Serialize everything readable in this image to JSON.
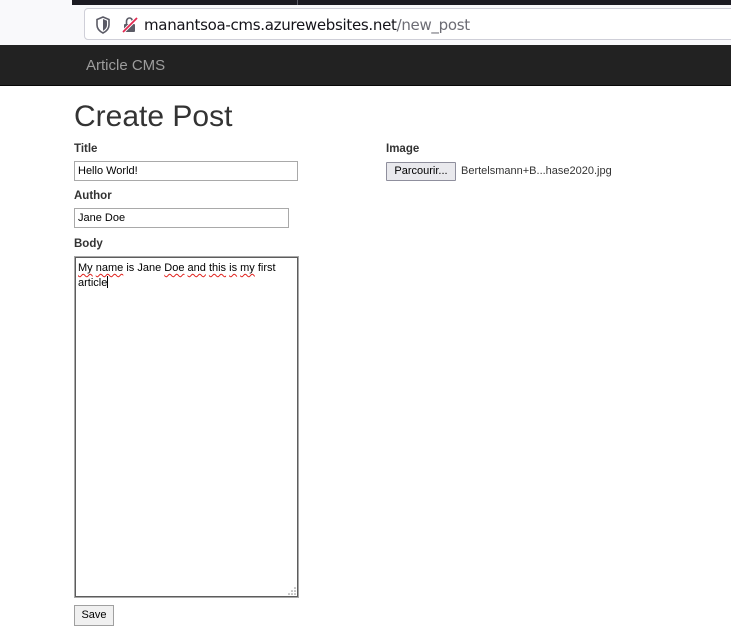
{
  "browser": {
    "url_domain": "manantsoa-cms.azurewebsites.net",
    "url_path": "/new_post"
  },
  "navbar": {
    "brand": "Article CMS"
  },
  "page": {
    "title": "Create Post"
  },
  "form": {
    "title_label": "Title",
    "title_value": "Hello World!",
    "author_label": "Author",
    "author_value": "Jane Doe",
    "body_label": "Body",
    "body_words": [
      "My",
      "name",
      "is",
      "Jane",
      "Doe",
      "and",
      "this",
      "is",
      "my",
      "first",
      "article"
    ],
    "image_label": "Image",
    "file_button_label": "Parcourir...",
    "file_name": "Bertelsmann+B...hase2020.jpg",
    "save_label": "Save"
  },
  "icons": {
    "shield": "shield-icon",
    "insecure_lock": "insecure-lock-icon",
    "resize": "resize-grip-icon"
  },
  "colors": {
    "navbar_bg": "#222222",
    "brand_text": "#9d9d9d",
    "spellcheck": "#e0201c"
  }
}
